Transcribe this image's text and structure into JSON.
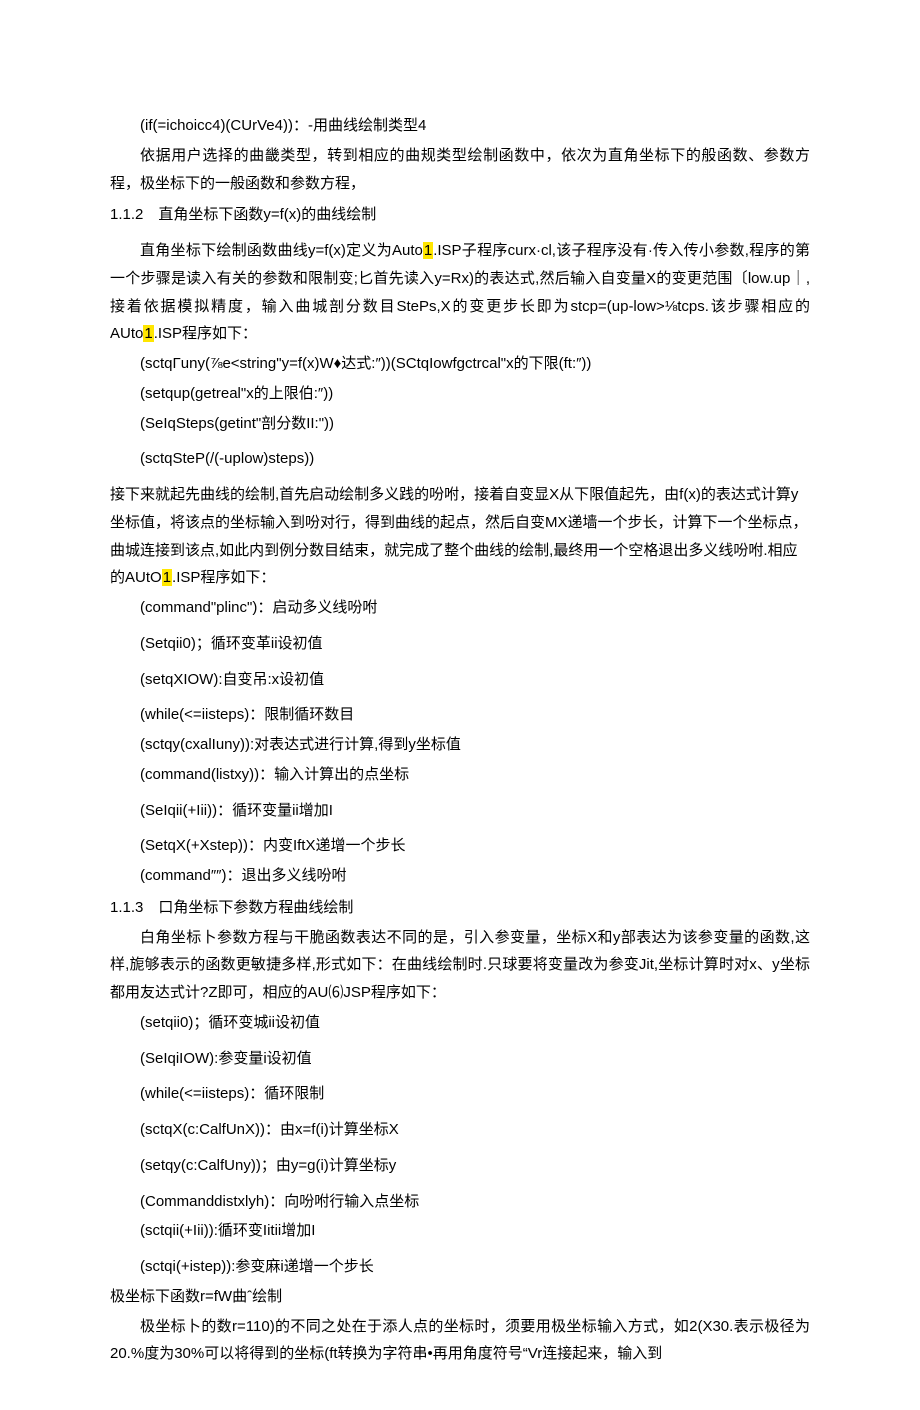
{
  "lines": {
    "l1": "(if(=ichoicc4)(CUrVe4))：-用曲线绘制类型4",
    "p1": "依据用户选择的曲畿类型，转到相应的曲规类型绘制函数中，依次为直角坐标下的般函数、参数方程，极坐标下的一般函数和参数方程，",
    "sec112": "1.1.2　直角坐标下函数y=f(x)的曲线绘制",
    "p2a": "直角坐标下绘制函数曲线y=f(x)定义为Auto",
    "p2hl1": "1",
    "p2b": ".ISP子程序curx·cl,该子程序没有·传入传小参数,程序的第一个步骤是读入有关的参数和限制变;匕首先读入y=Rx)的表达式,然后输入自变量X的变更范围〔low.up｜,接着依据模拟精度，输入曲城剖分数目StePs,X的变更步长即为stcp=(up-low>⅛tcps.该步骤相应的AUto",
    "p2hl2": "1",
    "p2c": ".ISP程序如下：",
    "c1": "(sctqΓuny(⅞e<string\"y=f(x)W♦达式:″))(SCtqIowfgctrcal\"x的下限(ft:″))",
    "c2": "(setqup(getreal\"x的上限伯:″))",
    "c3": "(SeIqSteps(getint\"剖分数II:\"))",
    "c4": "(sctqSteP(/(-uplow)steps))",
    "p3a": "接下来就起先曲线的绘制,首先启动绘制多义践的吩咐，接着自变显X从下限值起先，由f(x)的表达式计算y坐标值，将该点的坐标输入到吩对行，得到曲线的起点，然后自变MX递墙一个步长，计算下一个坐标点，曲城连接到该点,如此内到例分数目结束，就完成了整个曲线的绘制,最终用一个空格退出多义线吩咐.相应的AUtO",
    "p3hl": "1",
    "p3b": ".ISP程序如下：",
    "c5": "(command\"plinc\")：启动多义线吩咐",
    "c6": "(Setqii0)；循环变革ii设初值",
    "c7": "(setqXIOW):自变吊:x设初值",
    "c8": "(while(<=iisteps)：限制循环数目",
    "c9": "(sctqy(cxalIuny)):对表达式进行计算,得到y坐标值",
    "c10": "(command(listxy))：输入计算出的点坐标",
    "c11": "(SeIqii(+Iii))：循环变量ii增加I",
    "c12": "(SetqX(+Xstep))：内变IftX递增一个步长",
    "c13": "(command″″)：退出多义线吩咐",
    "sec113": "1.1.3　口角坐标下参数方程曲线绘制",
    "p4": "白角坐标卜参数方程与干脆函数表达不同的是，引入参变量，坐标X和y部表达为该参变量的函数,这样,旎够表示的函数更敏捷多样,形式如下：在曲线绘制时.只球要将变量改为参变Jit,坐标计算时对x、y坐标都用友达式计?Z即可，相应的AU⑹JSP程序如下：",
    "d1": "(setqii0)；循环变城ii设初值",
    "d2": "(SeIqiIOW):参变量i设初值",
    "d3": "(while(<=iisteps)：循环限制",
    "d4": "(sctqX(c:CalfUnX))：由x=f(i)计算坐标X",
    "d5": "(setqy(c:CalfUny))；由y=g(i)计算坐标y",
    "d6": "(Commanddistxlyh)：向吩咐行输入点坐标",
    "d7": "(sctqii(+Iii)):循环变Iitii增加I",
    "d8": "(sctqi(+istep)):参变麻i递增一个步长",
    "sec_polar": "极坐标下函数r=fW曲ˆ绘制",
    "p5": "极坐标卜的数r=110)的不同之处在于添人点的坐标时，须要用极坐标输入方式，如2(X30.表示极径为20.%度为30%可以将得到的坐标(ft转换为字符串•再用角度符号“Vr连接起来，输入到"
  }
}
